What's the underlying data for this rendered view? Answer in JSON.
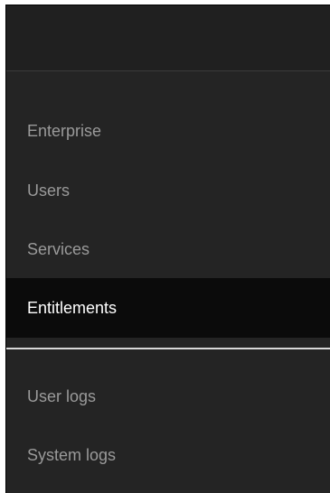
{
  "sidebar": {
    "items": [
      {
        "label": "Enterprise",
        "active": false
      },
      {
        "label": "Users",
        "active": false
      },
      {
        "label": "Services",
        "active": false
      },
      {
        "label": "Entitlements",
        "active": true
      }
    ],
    "log_items": [
      {
        "label": "User logs",
        "active": false
      },
      {
        "label": "System logs",
        "active": false
      }
    ]
  },
  "colors": {
    "background": "#242424",
    "active_background": "#0b0b0b",
    "text": "#9a9a9a",
    "active_text": "#ffffff",
    "divider": "#d9d9d9"
  }
}
